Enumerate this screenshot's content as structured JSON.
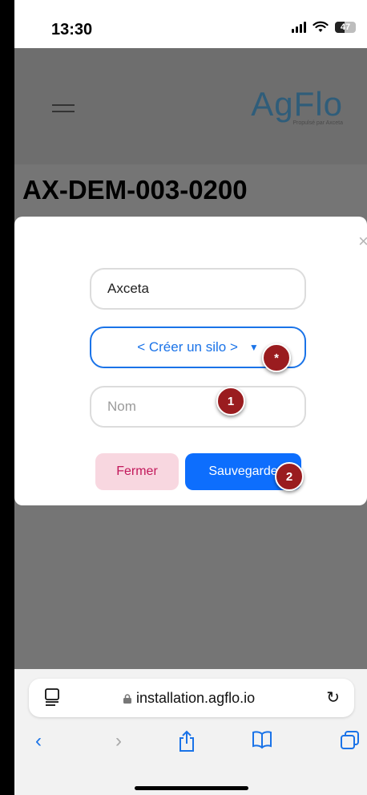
{
  "status_bar": {
    "time": "13:30",
    "battery": "47"
  },
  "header": {
    "logo_text": "AgFlo",
    "logo_subtitle": "Propulsé par Axceta"
  },
  "page": {
    "title": "AX-DEM-003-0200"
  },
  "modal": {
    "close_glyph": "×",
    "company_value": "Axceta",
    "silo_select_label": "< Créer un silo >",
    "name_placeholder": "Nom",
    "close_button_label": "Fermer",
    "save_button_label": "Sauvegarde"
  },
  "annotations": {
    "star": "*",
    "step1": "1",
    "step2": "2"
  },
  "browser": {
    "url": "installation.agflo.io"
  },
  "colors": {
    "accent": "#1a73e8",
    "save_button": "#0d6efd",
    "close_button_bg": "#f8d7e0",
    "close_button_text": "#c2185b",
    "marker": "#9a1c1f",
    "logo": "#2f5d7a"
  },
  "icons": {
    "status": [
      "signal-icon",
      "wifi-icon",
      "battery-icon"
    ],
    "browser": [
      "reader-icon",
      "lock-icon",
      "reload-icon",
      "back-icon",
      "forward-icon",
      "share-icon",
      "bookmarks-icon",
      "tabs-icon"
    ]
  }
}
